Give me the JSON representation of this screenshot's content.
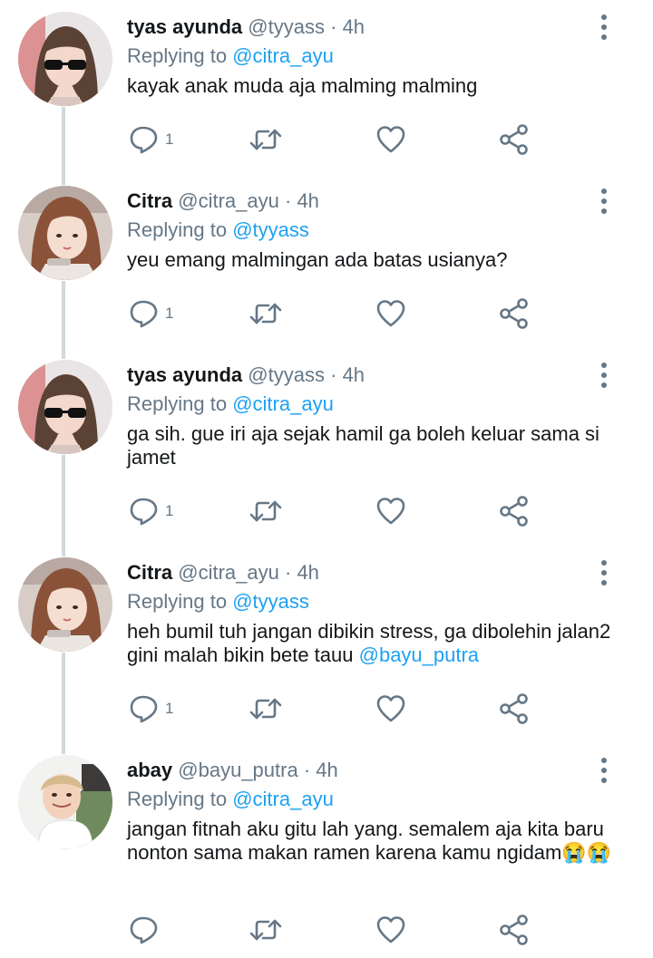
{
  "tweets": [
    {
      "name": "tyas ayunda",
      "handle": "@tyyass",
      "time": "4h",
      "replying_prefix": "Replying to",
      "replying_to": "@citra_ayu",
      "text": "kayak anak muda aja malming malming",
      "reply_count": "1"
    },
    {
      "name": "Citra",
      "handle": "@citra_ayu",
      "time": "4h",
      "replying_prefix": "Replying to",
      "replying_to": "@tyyass",
      "text": "yeu emang malmingan ada batas usianya?",
      "reply_count": "1"
    },
    {
      "name": "tyas ayunda",
      "handle": "@tyyass",
      "time": "4h",
      "replying_prefix": "Replying to",
      "replying_to": "@citra_ayu",
      "text": "ga sih. gue iri aja sejak hamil ga boleh keluar sama si jamet",
      "reply_count": "1"
    },
    {
      "name": "Citra",
      "handle": "@citra_ayu",
      "time": "4h",
      "replying_prefix": "Replying to",
      "replying_to": "@tyyass",
      "text": "heh bumil tuh jangan dibikin stress, ga dibolehin jalan2 gini malah bikin bete tauu ",
      "text_mention": "@bayu_putra",
      "reply_count": "1"
    },
    {
      "name": "abay",
      "handle": "@bayu_putra",
      "time": "4h",
      "replying_prefix": "Replying to",
      "replying_to": "@citra_ayu",
      "text": "jangan fitnah aku gitu lah yang. semalem aja kita baru nonton sama makan ramen karena kamu ngidam😭😭",
      "reply_count": ""
    }
  ],
  "separator": "·",
  "icons": {
    "reply": "reply-icon",
    "retweet": "retweet-icon",
    "like": "heart-icon",
    "share": "share-icon",
    "more": "more-vertical-icon"
  },
  "colors": {
    "text": "#14171a",
    "secondary": "#657786",
    "mention": "#1da1f2",
    "thread_line": "#cfd9de"
  }
}
